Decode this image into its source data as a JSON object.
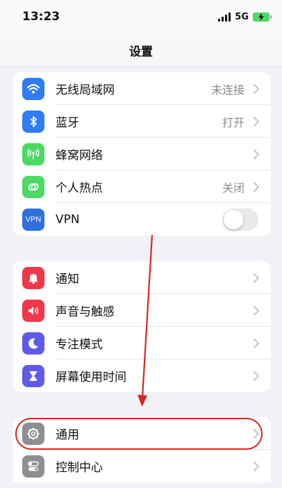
{
  "status": {
    "time": "13:23",
    "network": "5G"
  },
  "nav": {
    "title": "设置"
  },
  "groups": {
    "connectivity": {
      "wifi": {
        "label": "无线局域网",
        "value": "未连接"
      },
      "bluetooth": {
        "label": "蓝牙",
        "value": "打开"
      },
      "cellular": {
        "label": "蜂窝网络"
      },
      "hotspot": {
        "label": "个人热点",
        "value": "关闭"
      },
      "vpn": {
        "label": "VPN",
        "icon_text": "VPN",
        "toggle_on": false
      }
    },
    "notifications": {
      "notifications": {
        "label": "通知"
      },
      "sounds": {
        "label": "声音与触感"
      },
      "focus": {
        "label": "专注模式"
      },
      "screen_time": {
        "label": "屏幕使用时间"
      }
    },
    "general": {
      "general": {
        "label": "通用"
      },
      "control_center": {
        "label": "控制中心"
      }
    }
  },
  "colors": {
    "wifi": "#2f7cf6",
    "bluetooth": "#2f7cf6",
    "cellular": "#4cd964",
    "hotspot": "#4cd964",
    "vpn": "#2f6fe0",
    "notifications": "#f0384a",
    "sounds": "#f0384a",
    "focus": "#5e5ce6",
    "screen_time": "#5e5ce6",
    "general": "#8e8e93",
    "control_center": "#8e8e93",
    "annotation": "#d8261f"
  },
  "icons": {
    "wifi": "wifi-icon",
    "bluetooth": "bluetooth-icon",
    "cellular": "antenna-icon",
    "hotspot": "link-icon",
    "vpn": "vpn-icon",
    "notifications": "bell-icon",
    "sounds": "speaker-icon",
    "focus": "moon-icon",
    "screen_time": "hourglass-icon",
    "general": "gear-icon",
    "control_center": "toggles-icon"
  }
}
